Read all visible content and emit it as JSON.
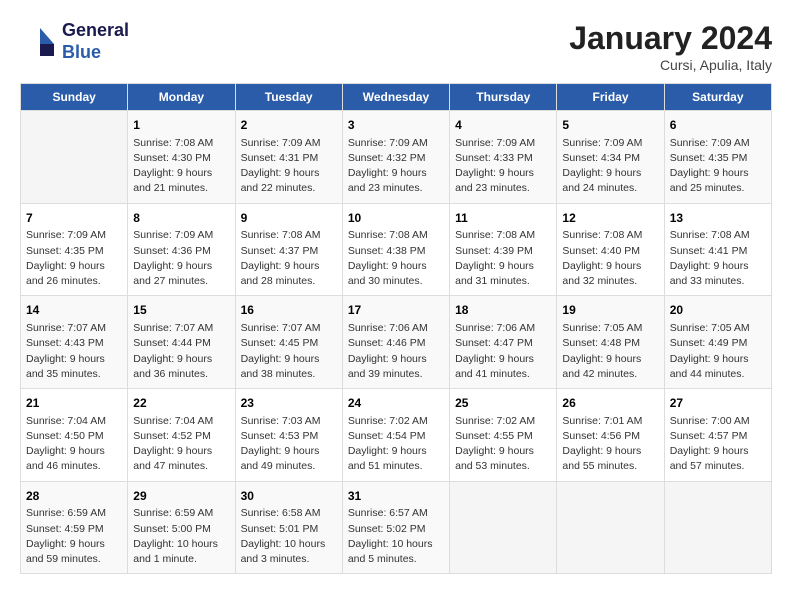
{
  "logo": {
    "line1": "General",
    "line2": "Blue"
  },
  "title": "January 2024",
  "subtitle": "Cursi, Apulia, Italy",
  "days_header": [
    "Sunday",
    "Monday",
    "Tuesday",
    "Wednesday",
    "Thursday",
    "Friday",
    "Saturday"
  ],
  "weeks": [
    [
      {
        "day": "",
        "info": ""
      },
      {
        "day": "1",
        "info": "Sunrise: 7:08 AM\nSunset: 4:30 PM\nDaylight: 9 hours\nand 21 minutes."
      },
      {
        "day": "2",
        "info": "Sunrise: 7:09 AM\nSunset: 4:31 PM\nDaylight: 9 hours\nand 22 minutes."
      },
      {
        "day": "3",
        "info": "Sunrise: 7:09 AM\nSunset: 4:32 PM\nDaylight: 9 hours\nand 23 minutes."
      },
      {
        "day": "4",
        "info": "Sunrise: 7:09 AM\nSunset: 4:33 PM\nDaylight: 9 hours\nand 23 minutes."
      },
      {
        "day": "5",
        "info": "Sunrise: 7:09 AM\nSunset: 4:34 PM\nDaylight: 9 hours\nand 24 minutes."
      },
      {
        "day": "6",
        "info": "Sunrise: 7:09 AM\nSunset: 4:35 PM\nDaylight: 9 hours\nand 25 minutes."
      }
    ],
    [
      {
        "day": "7",
        "info": "Sunrise: 7:09 AM\nSunset: 4:35 PM\nDaylight: 9 hours\nand 26 minutes."
      },
      {
        "day": "8",
        "info": "Sunrise: 7:09 AM\nSunset: 4:36 PM\nDaylight: 9 hours\nand 27 minutes."
      },
      {
        "day": "9",
        "info": "Sunrise: 7:08 AM\nSunset: 4:37 PM\nDaylight: 9 hours\nand 28 minutes."
      },
      {
        "day": "10",
        "info": "Sunrise: 7:08 AM\nSunset: 4:38 PM\nDaylight: 9 hours\nand 30 minutes."
      },
      {
        "day": "11",
        "info": "Sunrise: 7:08 AM\nSunset: 4:39 PM\nDaylight: 9 hours\nand 31 minutes."
      },
      {
        "day": "12",
        "info": "Sunrise: 7:08 AM\nSunset: 4:40 PM\nDaylight: 9 hours\nand 32 minutes."
      },
      {
        "day": "13",
        "info": "Sunrise: 7:08 AM\nSunset: 4:41 PM\nDaylight: 9 hours\nand 33 minutes."
      }
    ],
    [
      {
        "day": "14",
        "info": "Sunrise: 7:07 AM\nSunset: 4:43 PM\nDaylight: 9 hours\nand 35 minutes."
      },
      {
        "day": "15",
        "info": "Sunrise: 7:07 AM\nSunset: 4:44 PM\nDaylight: 9 hours\nand 36 minutes."
      },
      {
        "day": "16",
        "info": "Sunrise: 7:07 AM\nSunset: 4:45 PM\nDaylight: 9 hours\nand 38 minutes."
      },
      {
        "day": "17",
        "info": "Sunrise: 7:06 AM\nSunset: 4:46 PM\nDaylight: 9 hours\nand 39 minutes."
      },
      {
        "day": "18",
        "info": "Sunrise: 7:06 AM\nSunset: 4:47 PM\nDaylight: 9 hours\nand 41 minutes."
      },
      {
        "day": "19",
        "info": "Sunrise: 7:05 AM\nSunset: 4:48 PM\nDaylight: 9 hours\nand 42 minutes."
      },
      {
        "day": "20",
        "info": "Sunrise: 7:05 AM\nSunset: 4:49 PM\nDaylight: 9 hours\nand 44 minutes."
      }
    ],
    [
      {
        "day": "21",
        "info": "Sunrise: 7:04 AM\nSunset: 4:50 PM\nDaylight: 9 hours\nand 46 minutes."
      },
      {
        "day": "22",
        "info": "Sunrise: 7:04 AM\nSunset: 4:52 PM\nDaylight: 9 hours\nand 47 minutes."
      },
      {
        "day": "23",
        "info": "Sunrise: 7:03 AM\nSunset: 4:53 PM\nDaylight: 9 hours\nand 49 minutes."
      },
      {
        "day": "24",
        "info": "Sunrise: 7:02 AM\nSunset: 4:54 PM\nDaylight: 9 hours\nand 51 minutes."
      },
      {
        "day": "25",
        "info": "Sunrise: 7:02 AM\nSunset: 4:55 PM\nDaylight: 9 hours\nand 53 minutes."
      },
      {
        "day": "26",
        "info": "Sunrise: 7:01 AM\nSunset: 4:56 PM\nDaylight: 9 hours\nand 55 minutes."
      },
      {
        "day": "27",
        "info": "Sunrise: 7:00 AM\nSunset: 4:57 PM\nDaylight: 9 hours\nand 57 minutes."
      }
    ],
    [
      {
        "day": "28",
        "info": "Sunrise: 6:59 AM\nSunset: 4:59 PM\nDaylight: 9 hours\nand 59 minutes."
      },
      {
        "day": "29",
        "info": "Sunrise: 6:59 AM\nSunset: 5:00 PM\nDaylight: 10 hours\nand 1 minute."
      },
      {
        "day": "30",
        "info": "Sunrise: 6:58 AM\nSunset: 5:01 PM\nDaylight: 10 hours\nand 3 minutes."
      },
      {
        "day": "31",
        "info": "Sunrise: 6:57 AM\nSunset: 5:02 PM\nDaylight: 10 hours\nand 5 minutes."
      },
      {
        "day": "",
        "info": ""
      },
      {
        "day": "",
        "info": ""
      },
      {
        "day": "",
        "info": ""
      }
    ]
  ]
}
